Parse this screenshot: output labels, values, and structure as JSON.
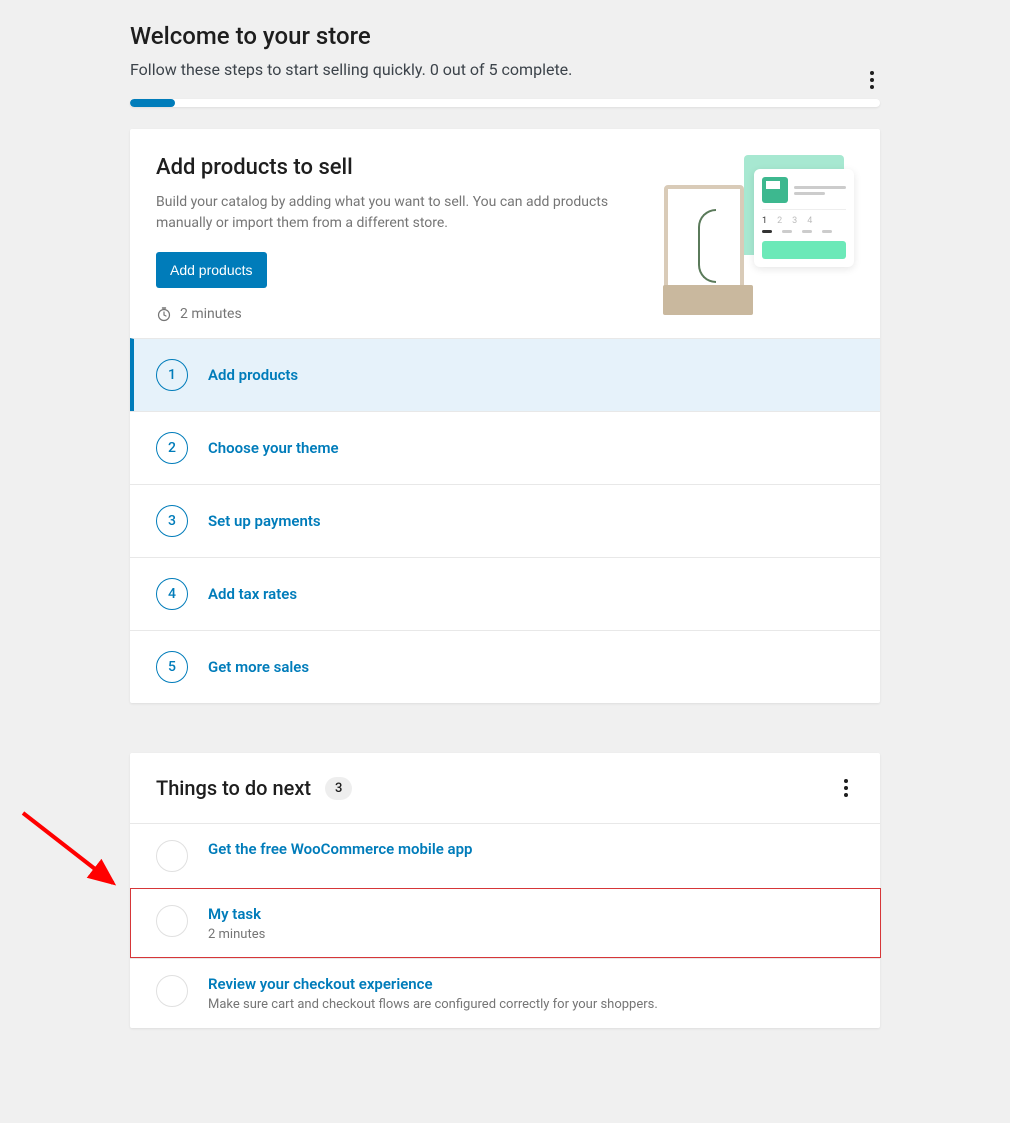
{
  "header": {
    "title": "Welcome to your store",
    "subtitle": "Follow these steps to start selling quickly. 0 out of 5 complete."
  },
  "progress": {
    "percent": 6
  },
  "hero": {
    "title": "Add products to sell",
    "description": "Build your catalog by adding what you want to sell. You can add products manually or import them from a different store.",
    "button": "Add products",
    "time": "2 minutes"
  },
  "steps": [
    {
      "num": "1",
      "label": "Add products",
      "active": true
    },
    {
      "num": "2",
      "label": "Choose your theme",
      "active": false
    },
    {
      "num": "3",
      "label": "Set up payments",
      "active": false
    },
    {
      "num": "4",
      "label": "Add tax rates",
      "active": false
    },
    {
      "num": "5",
      "label": "Get more sales",
      "active": false
    }
  ],
  "todo": {
    "title": "Things to do next",
    "count": "3",
    "items": [
      {
        "title": "Get the free WooCommerce mobile app",
        "sub": ""
      },
      {
        "title": "My task",
        "sub": "2 minutes",
        "highlight": true
      },
      {
        "title": "Review your checkout experience",
        "sub": "Make sure cart and checkout flows are configured correctly for your shoppers."
      }
    ]
  }
}
